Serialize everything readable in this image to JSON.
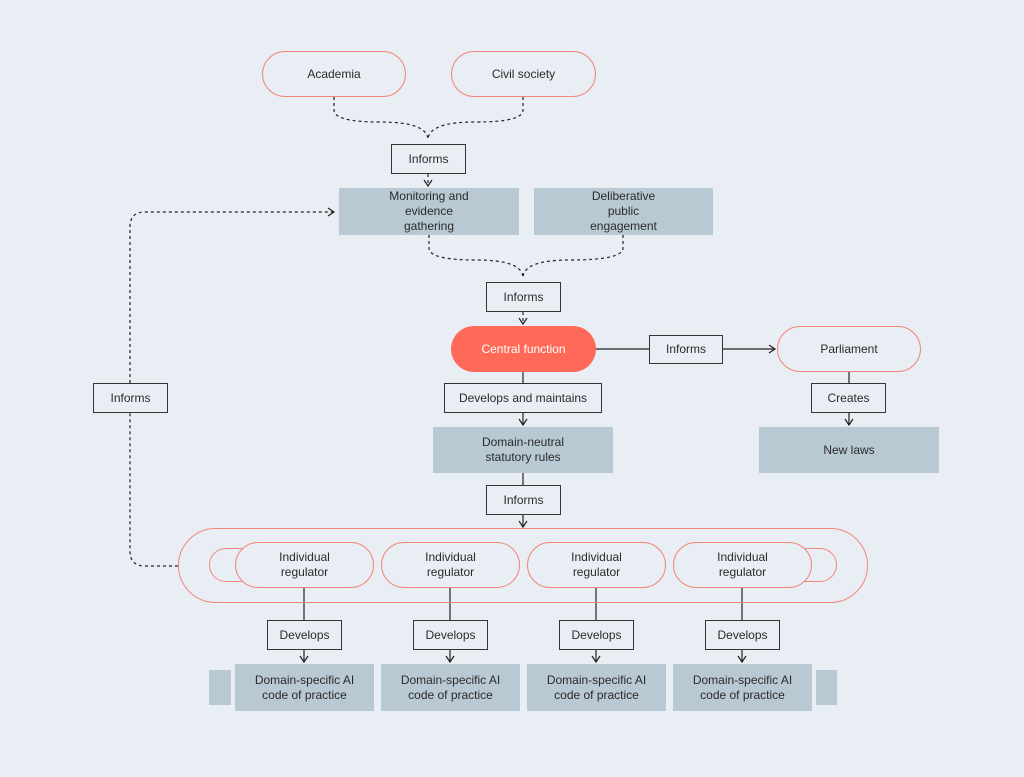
{
  "colors": {
    "background": "#e9eef5",
    "accent": "#ff6a58",
    "outline": "#f2877a",
    "box_fill": "#b9c9d3"
  },
  "nodes": {
    "academia": "Academia",
    "civil_society": "Civil society",
    "informs_top": "Informs",
    "monitoring": "Monitoring and evidence gathering",
    "deliberative": "Deliberative public engagement",
    "informs_mid": "Informs",
    "central": "Central function",
    "informs_right": "Informs",
    "parliament": "Parliament",
    "develops_maintains": "Develops and maintains",
    "creates": "Creates",
    "domain_neutral": "Domain-neutral statutory rules",
    "new_laws": "New laws",
    "informs_lower": "Informs",
    "informs_left": "Informs"
  },
  "regulators": [
    {
      "label": "Individual regulator",
      "action": "Develops",
      "output": "Domain-specific AI code of practice"
    },
    {
      "label": "Individual regulator",
      "action": "Develops",
      "output": "Domain-specific AI code of practice"
    },
    {
      "label": "Individual regulator",
      "action": "Develops",
      "output": "Domain-specific AI code of practice"
    },
    {
      "label": "Individual regulator",
      "action": "Develops",
      "output": "Domain-specific AI code of practice"
    }
  ]
}
